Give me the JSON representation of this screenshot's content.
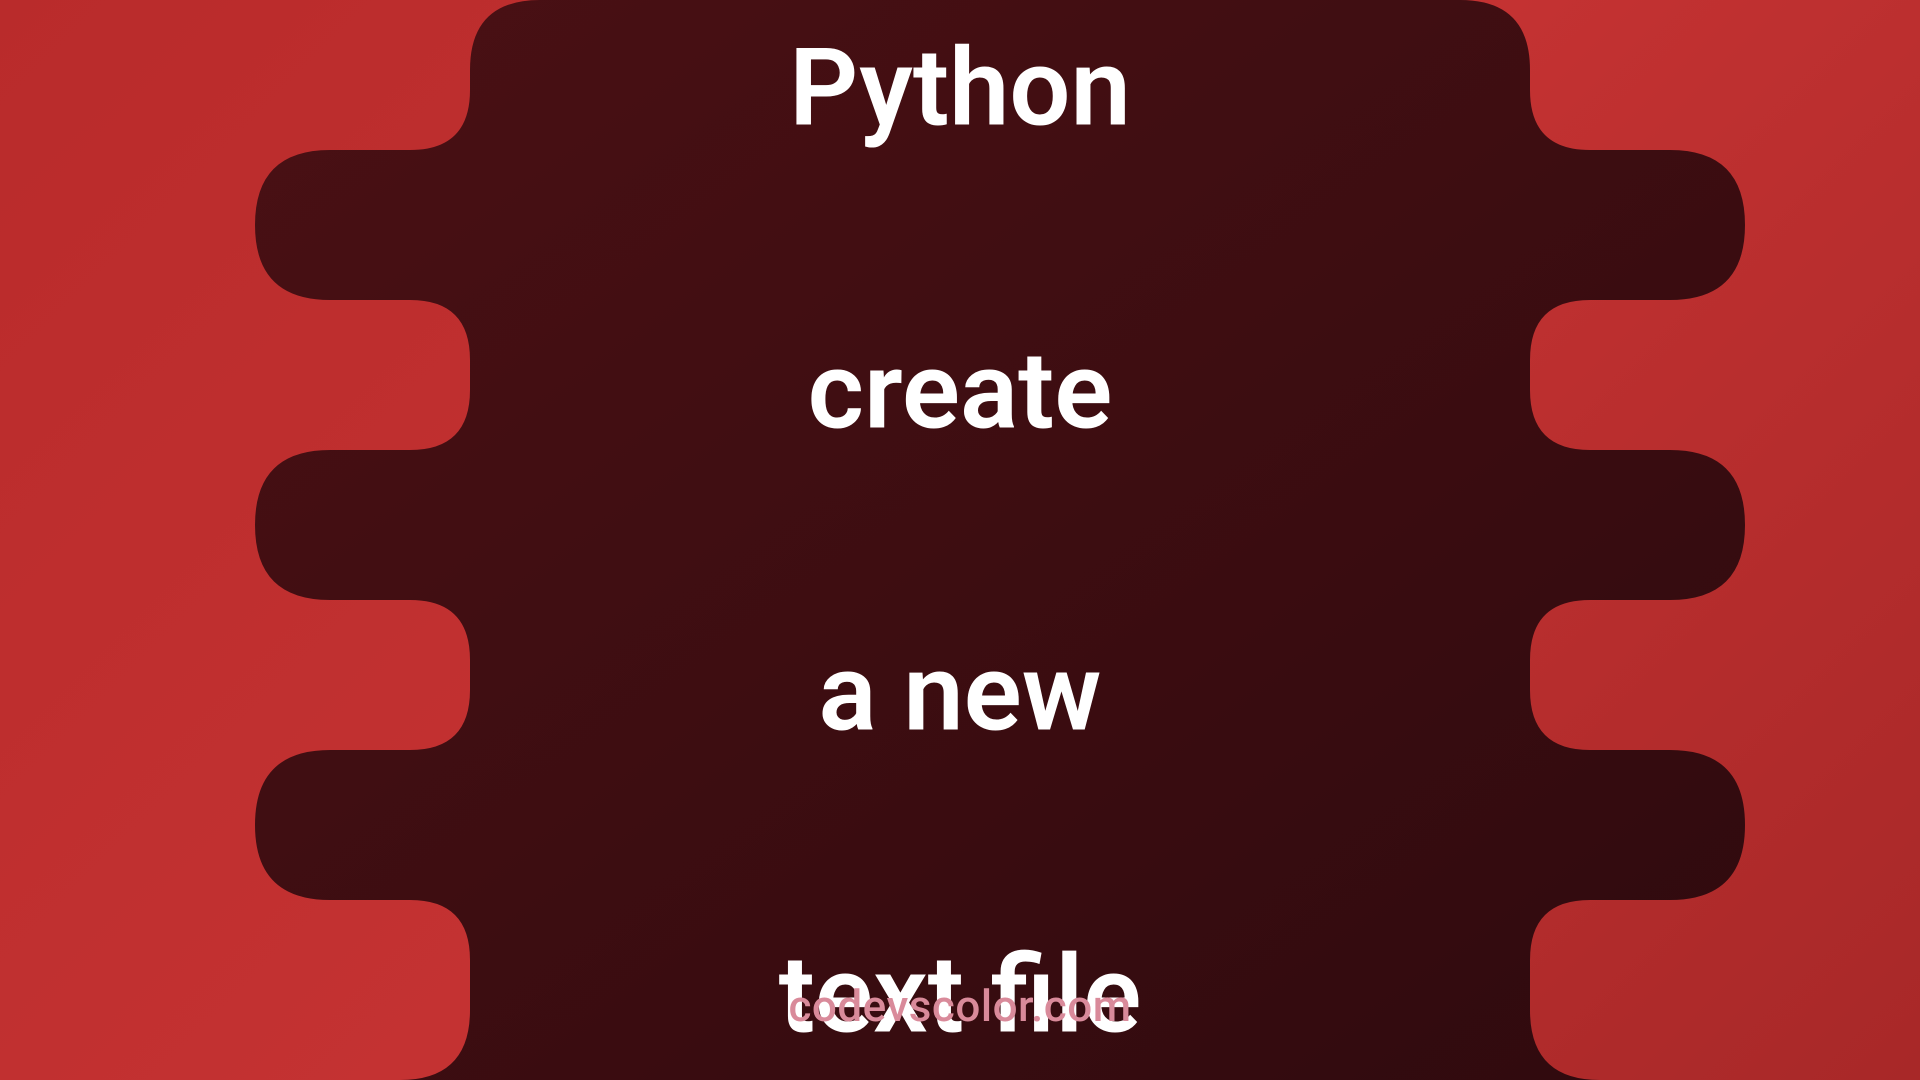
{
  "title": {
    "line1": "Python",
    "line2": "create",
    "line3": "a new",
    "line4": "text file"
  },
  "website": "codevscolor.com",
  "colors": {
    "background_bright": "#c43232",
    "background_dark": "#3d0f0f",
    "text_primary": "#ffffff",
    "text_secondary": "#d98a9a"
  }
}
